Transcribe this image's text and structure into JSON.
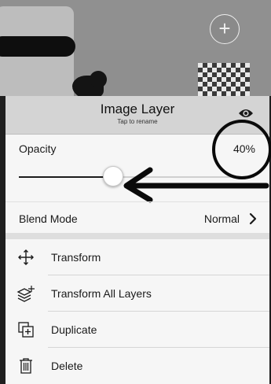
{
  "panel": {
    "title": "Image Layer",
    "subtitle": "Tap to rename",
    "visibility_icon": "eye-icon",
    "add_layer_icon": "plus-icon",
    "add_layer_symbol": "+"
  },
  "opacity": {
    "label": "Opacity",
    "value_text": "40%",
    "value": 0.4
  },
  "blend_mode": {
    "label": "Blend Mode",
    "value": "Normal",
    "icon": "chevron-right-icon"
  },
  "menu": {
    "items": [
      {
        "label": "Transform",
        "icon": "move-arrows-icon"
      },
      {
        "label": "Transform All Layers",
        "icon": "layers-move-icon"
      },
      {
        "label": "Duplicate",
        "icon": "duplicate-icon"
      },
      {
        "label": "Delete",
        "icon": "trash-icon"
      }
    ]
  },
  "annotations": {
    "circle_color": "#0a0a0a",
    "arrow_color": "#0a0a0a"
  },
  "colors": {
    "header_bg": "#d4d4d4",
    "sheet_bg": "#f6f6f6",
    "slider_fill": "#1c1c1c",
    "slider_track": "#cfcfcf"
  }
}
